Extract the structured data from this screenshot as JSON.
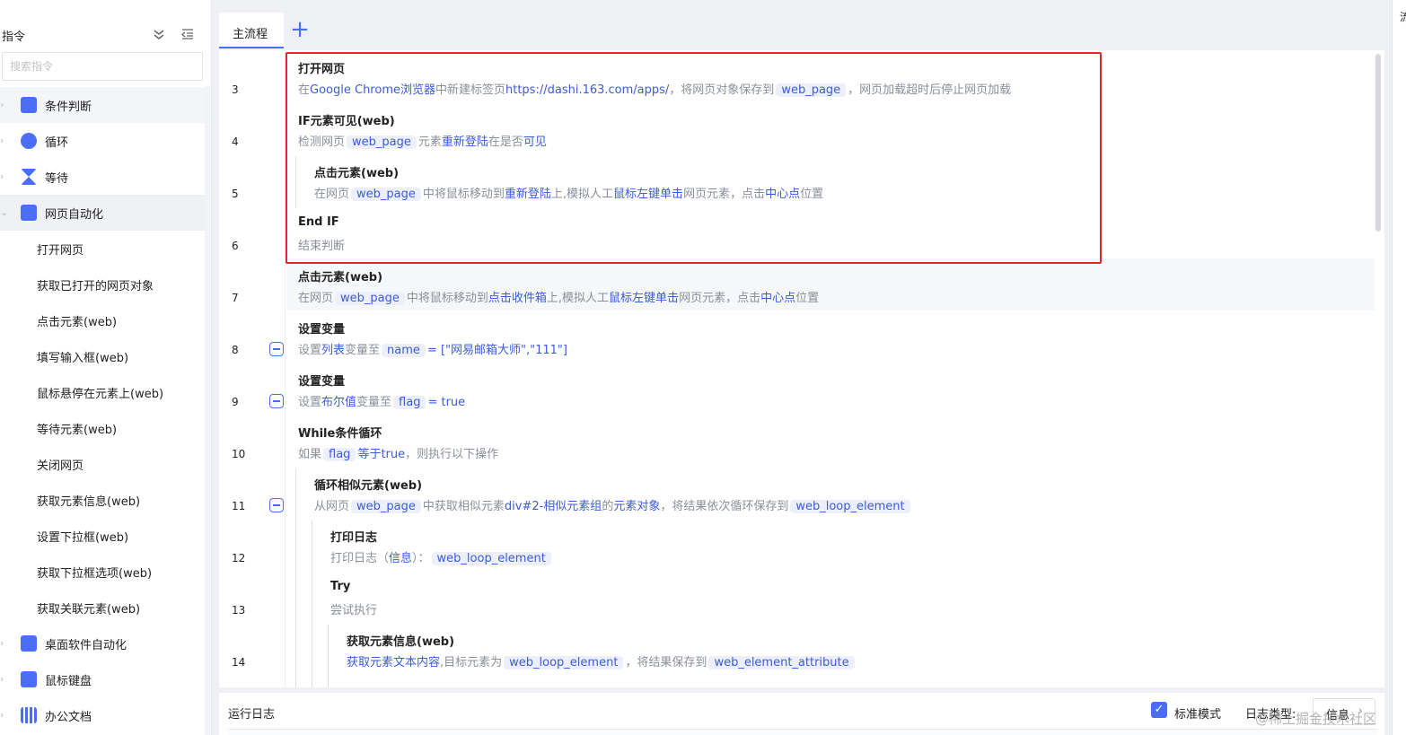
{
  "sidebar": {
    "title": "指令",
    "search_placeholder": "搜索指令",
    "categories": [
      {
        "label": "条件判断"
      },
      {
        "label": "循环"
      },
      {
        "label": "等待"
      },
      {
        "label": "网页自动化"
      },
      {
        "label": "桌面软件自动化"
      },
      {
        "label": "鼠标键盘"
      },
      {
        "label": "办公文档"
      }
    ],
    "web_items": [
      {
        "label": "打开网页"
      },
      {
        "label": "获取已打开的网页对象"
      },
      {
        "label": "点击元素(web)"
      },
      {
        "label": "填写输入框(web)"
      },
      {
        "label": "鼠标悬停在元素上(web)"
      },
      {
        "label": "等待元素(web)"
      },
      {
        "label": "关闭网页"
      },
      {
        "label": "获取元素信息(web)"
      },
      {
        "label": "设置下拉框(web)"
      },
      {
        "label": "获取下拉框选项(web)"
      },
      {
        "label": "获取关联元素(web)"
      }
    ]
  },
  "tabs": {
    "main": "主流程",
    "add": "+"
  },
  "flow": {
    "lines": [
      "3",
      "4",
      "5",
      "6",
      "7",
      "8",
      "9",
      "10",
      "11",
      "12",
      "13",
      "14"
    ],
    "steps": {
      "s3": {
        "title": "打开网页",
        "p1": "在",
        "k1": "Google Chrome浏览器",
        "p2": "中新建标签页",
        "k2": "https://dashi.163.com/apps/",
        "p3": "，将网页对象保存到",
        "v1": "web_page",
        "p4": "，网页加载超时后停止网页加载"
      },
      "s4": {
        "title": "IF元素可见(web)",
        "p1": "检测网页",
        "v1": "web_page",
        "p2": "元素",
        "k1": "重新登陆",
        "p3": "在是否",
        "k2": "可见"
      },
      "s5": {
        "title": "点击元素(web)",
        "p1": "在网页",
        "v1": "web_page",
        "p2": "中将鼠标移动到",
        "k1": "重新登陆",
        "p3": "上,模拟人工",
        "k2": "鼠标左键单击",
        "p4": "网页元素，点击",
        "k3": "中心点",
        "p5": "位置"
      },
      "s6": {
        "title": "End IF",
        "p1": "结束判断"
      },
      "s7": {
        "title": "点击元素(web)",
        "p1": "在网页",
        "v1": "web_page",
        "p2": "中将鼠标移动到",
        "k1": "点击收件箱",
        "p3": "上,模拟人工",
        "k2": "鼠标左键单击",
        "p4": "网页元素，点击",
        "k3": "中心点",
        "p5": "位置"
      },
      "s8": {
        "title": "设置变量",
        "p1": "设置",
        "k1": "列表",
        "p2": "变量至",
        "v1": "name",
        "k2": "= [\"网易邮箱大师\",\"111\"]"
      },
      "s9": {
        "title": "设置变量",
        "p1": "设置",
        "k1": "布尔值",
        "p2": "变量至",
        "v1": "flag",
        "k2": "= true"
      },
      "s10": {
        "title": "While条件循环",
        "p1": "如果",
        "v1": "flag",
        "k1": "等于",
        "k2": "true",
        "p2": "，则执行以下操作"
      },
      "s11": {
        "title": "循环相似元素(web)",
        "p1": "从网页",
        "v1": "web_page",
        "p2": "中获取相似元素",
        "k1": "div#2-相似元素组",
        "p3": "的",
        "k2": "元素对象",
        "p4": "，将结果依次循环保存到",
        "v2": "web_loop_element"
      },
      "s12": {
        "title": "打印日志",
        "p1": "打印日志（",
        "k1": "信息",
        "p2": "）：",
        "v1": "web_loop_element"
      },
      "s13": {
        "title": "Try",
        "p1": "尝试执行"
      },
      "s14": {
        "title": "获取元素信息(web)",
        "k1": "获取元素文本内容",
        "p1": ",目标元素为",
        "v1": "web_loop_element",
        "p2": "，将结果保存到",
        "v2": "web_element_attribute"
      }
    }
  },
  "log": {
    "title": "运行日志",
    "standard_mode": "标准模式",
    "standard_checked": true,
    "log_type_label": "日志类型:",
    "log_type_value": "信息"
  },
  "right_strip_glyph": "流",
  "watermark": "@稀土掘金技术社区",
  "colors": {
    "accent": "#4a6cf7",
    "highlight_box": "#e5262d",
    "keyword": "#3b5bdb"
  }
}
